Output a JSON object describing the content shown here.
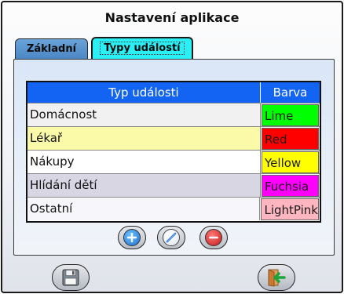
{
  "window": {
    "title": "Nastavení aplikace"
  },
  "tabs": [
    {
      "label": "Základní",
      "active": false
    },
    {
      "label": "Typy událostí",
      "active": true
    }
  ],
  "table": {
    "headers": {
      "type": "Typ události",
      "color": "Barva"
    },
    "rows": [
      {
        "type": "Domácnost",
        "color": "Lime",
        "row_bg": "#f1f1f1",
        "swatch": "#00ff00"
      },
      {
        "type": "Lékař",
        "color": "Red",
        "row_bg": "#fafaa8",
        "swatch": "#ff0000"
      },
      {
        "type": "Nákupy",
        "color": "Yellow",
        "row_bg": "#ffffff",
        "swatch": "#ffff00"
      },
      {
        "type": "Hlídání dětí",
        "color": "Fuchsia",
        "row_bg": "#d9d6e3",
        "swatch": "#ff00ff"
      },
      {
        "type": "Ostatní",
        "color": "LightPink",
        "row_bg": "#f7f7fb",
        "swatch": "#ffb6c1"
      }
    ]
  },
  "buttons": {
    "add": {
      "icon": "plus-icon"
    },
    "edit": {
      "icon": "pencil-icon"
    },
    "delete": {
      "icon": "minus-icon"
    },
    "save": {
      "icon": "floppy-disk-icon"
    },
    "exit": {
      "icon": "exit-door-icon"
    }
  },
  "colors": {
    "header_bg": "#1464f4",
    "active_tab": "#2af0f5",
    "inactive_tab": "#4a86c4"
  }
}
